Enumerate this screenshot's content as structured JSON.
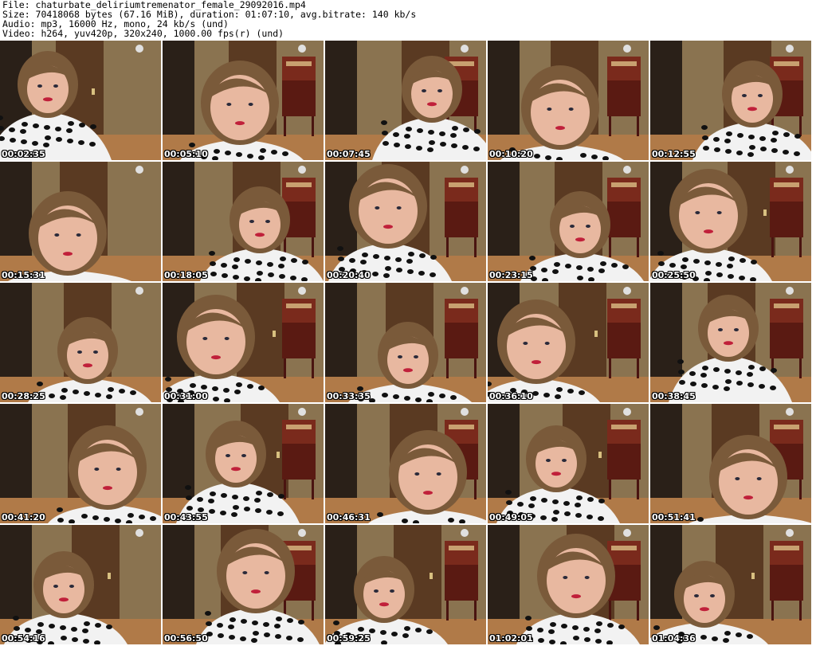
{
  "header": {
    "file_line": "File: chaturbate_deliriumtremenator_female_29092016.mp4",
    "size_line": "Size: 70418068 bytes (67.16 MiB), duration: 01:07:10, avg.bitrate: 140 kb/s",
    "audio_line": "Audio: mp3, 16000 Hz, mono, 24 kb/s (und)",
    "video_line": "Video: h264, yuv420p, 320x240, 1000.00 fps(r) (und)"
  },
  "thumbnails": [
    {
      "timestamp": "00:02:35"
    },
    {
      "timestamp": "00:05:10"
    },
    {
      "timestamp": "00:07:45"
    },
    {
      "timestamp": "00:10:20"
    },
    {
      "timestamp": "00:12:55"
    },
    {
      "timestamp": "00:15:31"
    },
    {
      "timestamp": "00:18:05"
    },
    {
      "timestamp": "00:20:40"
    },
    {
      "timestamp": "00:23:15"
    },
    {
      "timestamp": "00:25:50"
    },
    {
      "timestamp": "00:28:25"
    },
    {
      "timestamp": "00:31:00"
    },
    {
      "timestamp": "00:33:35"
    },
    {
      "timestamp": "00:36:10"
    },
    {
      "timestamp": "00:38:45"
    },
    {
      "timestamp": "00:41:20"
    },
    {
      "timestamp": "00:43:55"
    },
    {
      "timestamp": "00:46:31"
    },
    {
      "timestamp": "00:49:05"
    },
    {
      "timestamp": "00:51:41"
    },
    {
      "timestamp": "00:54:16"
    },
    {
      "timestamp": "00:56:50"
    },
    {
      "timestamp": "00:59:25"
    },
    {
      "timestamp": "01:02:01"
    },
    {
      "timestamp": "01:04:36"
    }
  ],
  "colors": {
    "wall": "#8a7350",
    "door": "#5a3a22",
    "floor": "#b07a48",
    "skin": "#e8b8a0",
    "hair": "#7a5a3a",
    "top": "#f2f2f2",
    "dots": "#111111"
  }
}
